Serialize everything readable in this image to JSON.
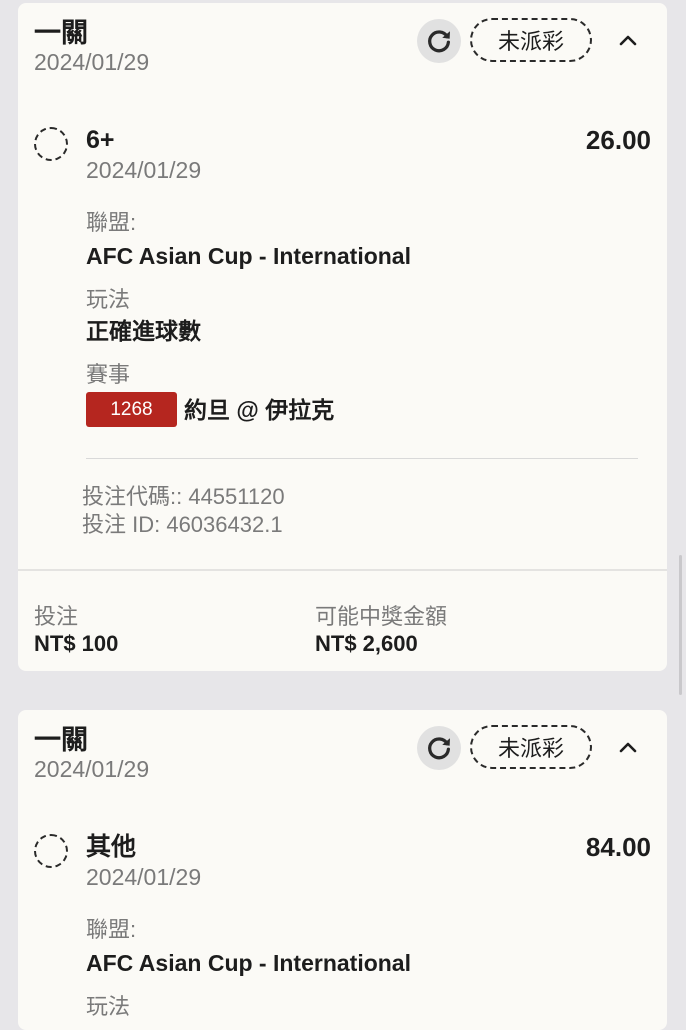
{
  "bets": [
    {
      "type_label": "一關",
      "date": "2024/01/29",
      "status": "未派彩",
      "selection": {
        "name": "6+",
        "date": "2024/01/29",
        "odds": "26.00"
      },
      "league_label": "聯盟:",
      "league": "AFC Asian Cup - International",
      "market_label": "玩法",
      "market": "正確進球數",
      "event_label": "賽事",
      "event_id": "1268",
      "event_name": "約旦 @ 伊拉克",
      "bet_code": "投注代碼:: 44551120",
      "bet_id": "投注 ID: 46036432.1",
      "stake_label": "投注",
      "stake": "NT$ 100",
      "payout_label": "可能中獎金額",
      "payout": "NT$ 2,600"
    },
    {
      "type_label": "一關",
      "date": "2024/01/29",
      "status": "未派彩",
      "selection": {
        "name": "其他",
        "date": "2024/01/29",
        "odds": "84.00"
      },
      "league_label": "聯盟:",
      "league": "AFC Asian Cup - International",
      "market_label": "玩法"
    }
  ],
  "icons": {
    "refresh": "refresh-icon",
    "collapse": "chevron-up-icon",
    "selection": "dashed-circle-icon"
  },
  "colors": {
    "background": "#e7e6e9",
    "card": "#fbfaf6",
    "event_badge": "#b5261f",
    "muted_text": "#7a7a7a"
  }
}
